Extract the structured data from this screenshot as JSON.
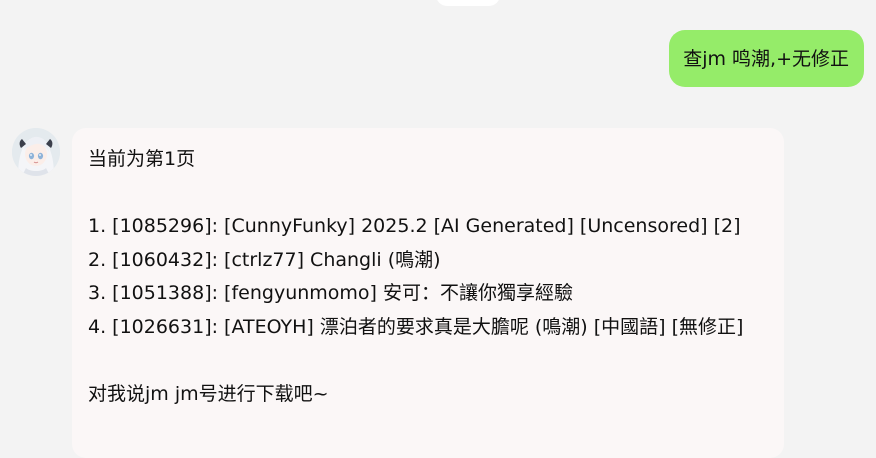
{
  "outgoing_message": {
    "text": "查jm 鸣潮,+无修正",
    "bubble_color": "#95ec69"
  },
  "incoming_message": {
    "avatar": "anime-girl-avatar",
    "bubble_color": "#fbf7f7",
    "header": "当前为第1页",
    "results": [
      "1. [1085296]: [CunnyFunky] 2025.2 [AI Generated] [Uncensored] [2]",
      "2. [1060432]: [ctrlz77] Changli (鳴潮)",
      "3. [1051388]: [fengyunmomo] 安可：不讓你獨享經驗",
      "4. [1026631]: [ATEOYH] 漂泊者的要求真是大膽呢 (鳴潮) [中國語] [無修正]"
    ],
    "footer": "对我说jm jm号进行下载吧~"
  }
}
